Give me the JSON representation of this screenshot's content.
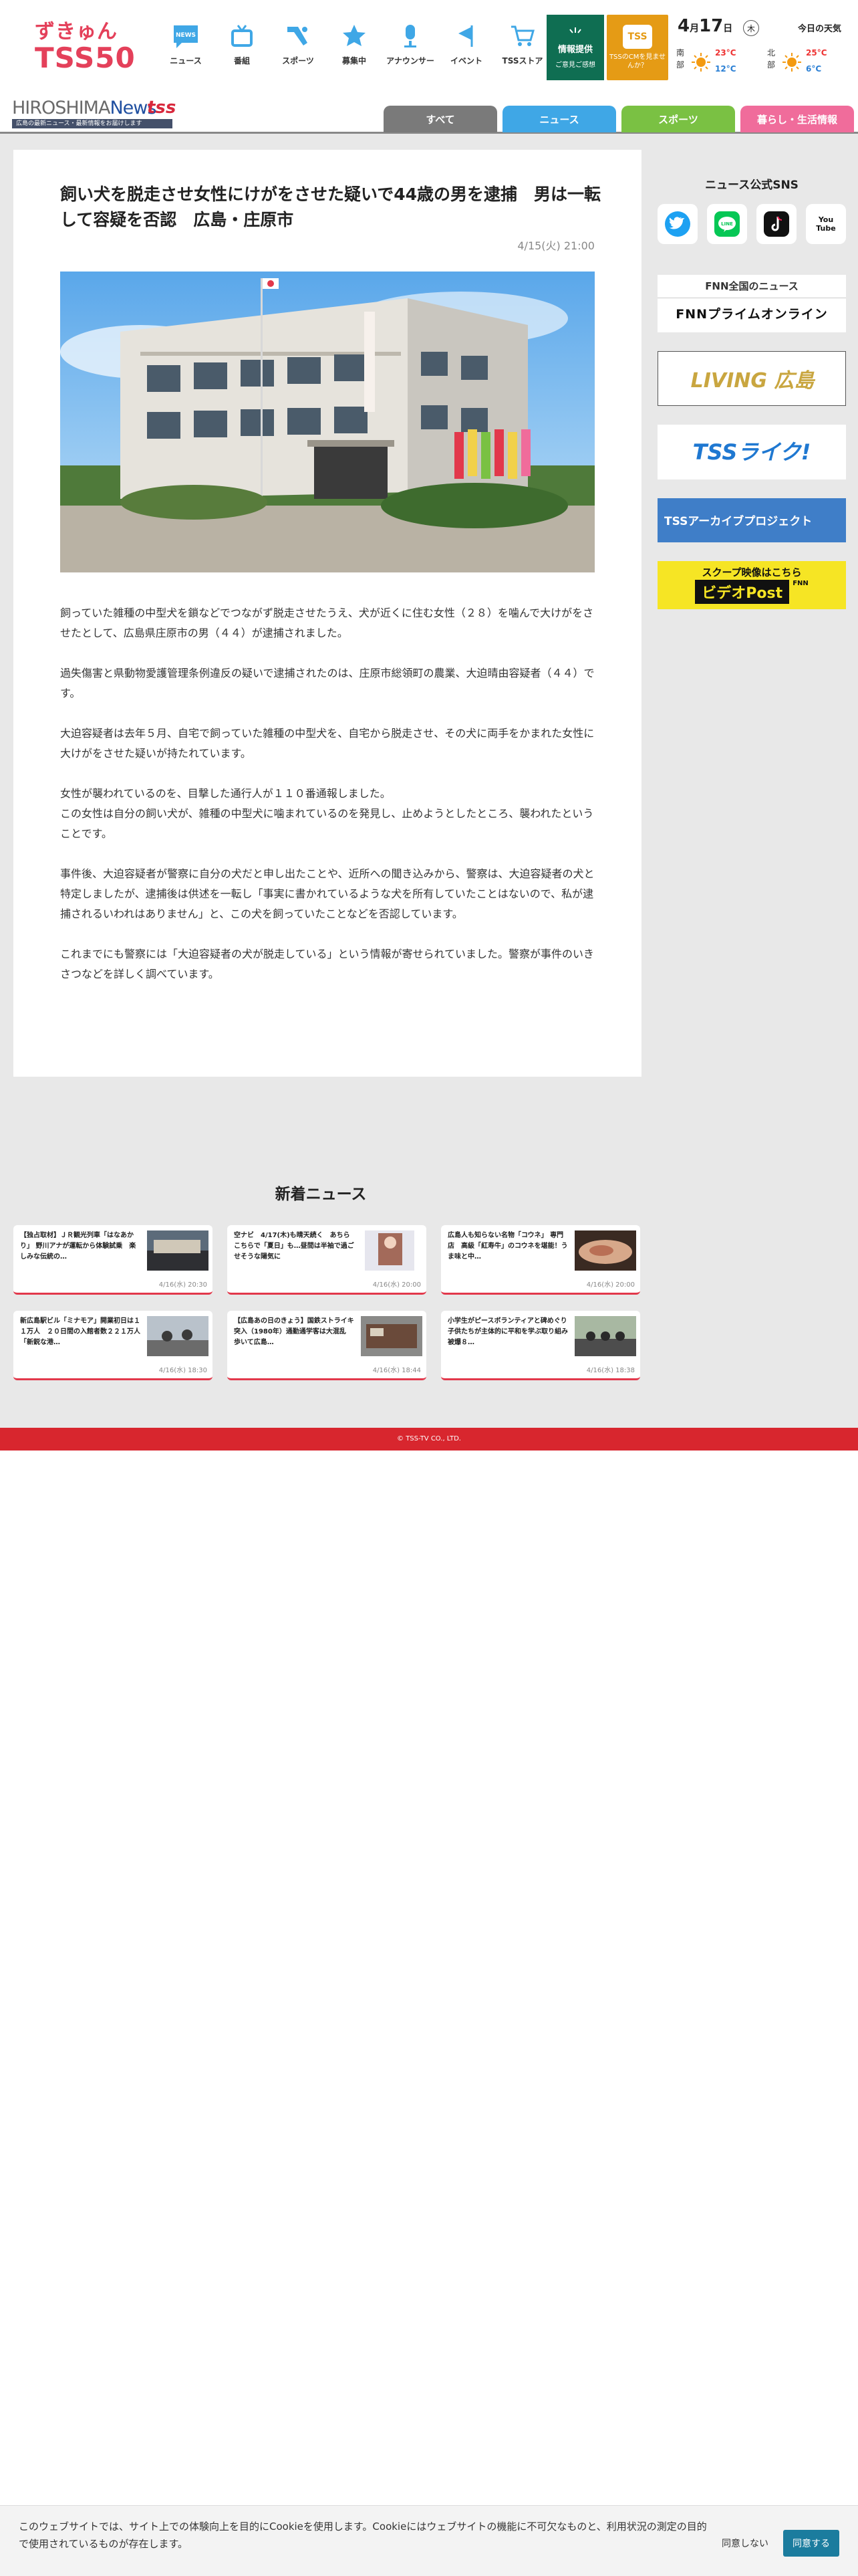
{
  "header": {
    "logo_line1": "ずきゅん",
    "logo_line2": "TSS50",
    "nav": [
      {
        "label": "ニュース",
        "icon": "news-icon"
      },
      {
        "label": "番組",
        "icon": "tv-icon"
      },
      {
        "label": "スポーツ",
        "icon": "sports-icon"
      },
      {
        "label": "募集中",
        "icon": "star-icon"
      },
      {
        "label": "アナウンサー",
        "icon": "microphone-icon"
      },
      {
        "label": "イベント",
        "icon": "flag-icon"
      },
      {
        "label": "TSSストア",
        "icon": "cart-icon"
      }
    ],
    "info_button": {
      "title": "情報提供",
      "sub": "ご意見ご感想"
    },
    "cm_button": {
      "face": "TSS",
      "text": "TSSのCMを見ませんか？"
    },
    "weather": {
      "month": "4",
      "month_unit": "月",
      "day": "17",
      "day_unit": "日",
      "dow": "木",
      "today_label": "今日の天気",
      "regions": [
        {
          "name": "南部",
          "high": "23°C",
          "low": "12°C",
          "icon": "sun-icon"
        },
        {
          "name": "北部",
          "high": "25°C",
          "low": "6°C",
          "icon": "sun-icon"
        }
      ]
    }
  },
  "subheader": {
    "logo_text_a": "HIROSHIMA",
    "logo_text_b": "News",
    "logo_tss": "tss",
    "logo_strip": "広島の最新ニュース・最新情報をお届けします",
    "tabs": [
      {
        "label": "すべて",
        "color": "#7a7a7a"
      },
      {
        "label": "ニュース",
        "color": "#3fa7e6"
      },
      {
        "label": "スポーツ",
        "color": "#7ac143"
      },
      {
        "label": "暮らし・生活情報",
        "color": "#f06c9b"
      }
    ]
  },
  "article": {
    "title": "飼い犬を脱走させ女性にけがをさせた疑いで44歳の男を逮捕　男は一転して容疑を否認　広島・庄原市",
    "datetime": "4/15(火) 21:00",
    "paragraphs": [
      "飼っていた雑種の中型犬を鎖などでつながず脱走させたうえ、犬が近くに住む女性（２８）を噛んで大けがをさせたとして、広島県庄原市の男（４４）が逮捕されました。",
      "過失傷害と県動物愛護管理条例違反の疑いで逮捕されたのは、庄原市総領町の農業、大迫晴由容疑者（４４）です。",
      "大迫容疑者は去年５月、自宅で飼っていた雑種の中型犬を、自宅から脱走させ、その犬に両手をかまれた女性に大けがをさせた疑いが持たれています。",
      "女性が襲われているのを、目撃した通行人が１１０番通報しました。\nこの女性は自分の飼い犬が、雑種の中型犬に噛まれているのを発見し、止めようとしたところ、襲われたということです。",
      "事件後、大迫容疑者が警察に自分の犬だと申し出たことや、近所への聞き込みから、警察は、大迫容疑者の犬と特定しましたが、逮捕後は供述を一転し「事実に書かれているような犬を所有していたことはないので、私が逮捕されるいわれはありません」と、この犬を飼っていたことなどを否認しています。",
      "これまでにも警察には「大迫容疑者の犬が脱走している」という情報が寄せられていました。警察が事件のいきさつなどを詳しく調べています。"
    ]
  },
  "sidebar": {
    "sns_title": "ニュース公式SNS",
    "sns": [
      {
        "name": "twitter",
        "color": "#1da1f2",
        "icon": "twitter-icon"
      },
      {
        "name": "line",
        "color": "#06c755",
        "icon": "line-icon"
      },
      {
        "name": "tiktok",
        "color": "#111111",
        "icon": "tiktok-icon"
      },
      {
        "name": "youtube",
        "color": "#111111",
        "icon": "youtube-icon",
        "text": "You Tube"
      }
    ],
    "banners": {
      "fnn_title": "FNN全国のニュース",
      "fnn_logo": "FNNプライムオンライン",
      "living": "LIVING 広島",
      "tss_live": "TSSライク!",
      "archive": "TSSアーカイブプロジェクト",
      "video_post_top": "スクープ映像はこちら",
      "video_post": "ビデオPost",
      "video_post_fnn": "FNN"
    }
  },
  "latest": {
    "title": "新着ニュース",
    "items": [
      {
        "title": "【独占取材】ＪＲ観光列車「はなあかり」 野川アナが運転から体験試乗　楽しみな伝統の…",
        "date": "4/16(水) 20:30"
      },
      {
        "title": "空ナビ　4/17(木)も晴天続く　あちらこちらで「夏日」も…昼間は半袖で過ごせそうな陽気に",
        "date": "4/16(水) 20:00"
      },
      {
        "title": "広島人も知らない名物「コウネ」 専門店　高級「紅寿牛」のコウネを堪能！うま味と中…",
        "date": "4/16(水) 20:00"
      },
      {
        "title": "新広島駅ビル「ミナモア」開業初日は１１万人　２０日間の入館者数２２１万人「新鋭な港…",
        "date": "4/16(水) 18:30"
      },
      {
        "title": "【広島あの日のきょう】国鉄ストライキ突入（1980年）通勤通学客は大混乱　歩いて広島…",
        "date": "4/16(水) 18:44"
      },
      {
        "title": "小学生がピースボランティアと碑めぐり　子供たちが主体的に平和を学ぶ取り組み　被爆８…",
        "date": "4/16(水) 18:38"
      }
    ]
  },
  "footer": {
    "copyright": "© TSS-TV CO., LTD."
  },
  "cookie": {
    "message": "このウェブサイトでは、サイト上での体験向上を目的にCookieを使用します。Cookieにはウェブサイトの機能に不可欠なものと、利用状況の測定の目的で使用されているものが存在します。",
    "deny": "同意しない",
    "agree": "同意する"
  }
}
